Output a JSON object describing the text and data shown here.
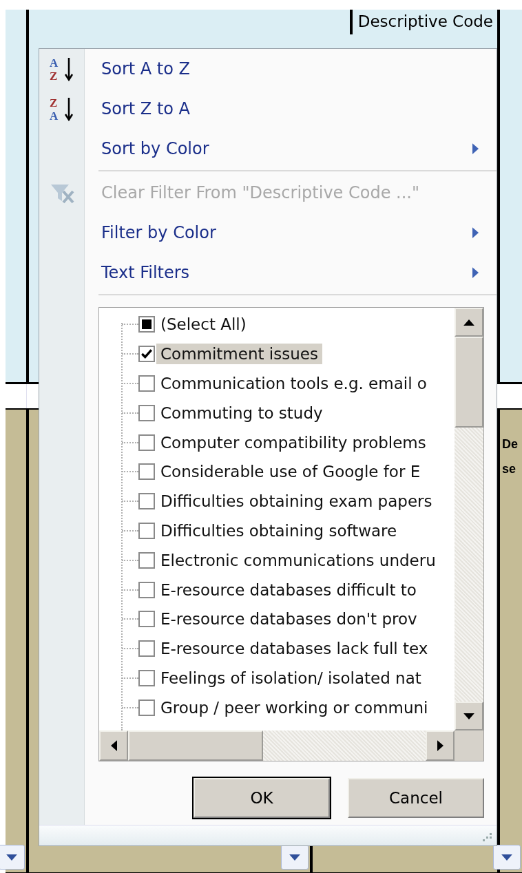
{
  "sheet": {
    "header_cell": "Descriptive Code",
    "cell_fragment": [
      "De",
      "se"
    ]
  },
  "menu": {
    "items": [
      {
        "kind": "command",
        "label": "Sort A to Z",
        "icon_text": [
          "A",
          "Z"
        ],
        "disabled": false,
        "submenu": false
      },
      {
        "kind": "command",
        "label": "Sort Z to A",
        "icon_text": [
          "Z",
          "A"
        ],
        "disabled": false,
        "submenu": false
      },
      {
        "kind": "command",
        "label": "Sort by Color",
        "disabled": false,
        "submenu": true
      },
      {
        "kind": "separator"
      },
      {
        "kind": "command",
        "label": "Clear Filter From \"Descriptive Code ...\"",
        "disabled": true,
        "submenu": false
      },
      {
        "kind": "command",
        "label": "Filter by Color",
        "disabled": false,
        "submenu": true
      },
      {
        "kind": "command",
        "label": "Text Filters",
        "disabled": false,
        "submenu": true
      },
      {
        "kind": "separator"
      }
    ],
    "values": [
      {
        "label": "(Select All)",
        "checked": false,
        "indeterminate": true,
        "selected": false
      },
      {
        "label": "Commitment issues",
        "checked": true,
        "selected": true
      },
      {
        "label": "Communication tools e.g. email o",
        "checked": false,
        "selected": false
      },
      {
        "label": "Commuting to study",
        "checked": false,
        "selected": false
      },
      {
        "label": "Computer compatibility problems",
        "checked": false,
        "selected": false
      },
      {
        "label": "Considerable use of Google for E",
        "checked": false,
        "selected": false
      },
      {
        "label": "Difficulties obtaining exam papers",
        "checked": false,
        "selected": false
      },
      {
        "label": "Difficulties obtaining software",
        "checked": false,
        "selected": false
      },
      {
        "label": "Electronic communications underu",
        "checked": false,
        "selected": false
      },
      {
        "label": "E-resource databases difficult to",
        "checked": false,
        "selected": false
      },
      {
        "label": "E-resource databases don't prov",
        "checked": false,
        "selected": false
      },
      {
        "label": "E-resource databases lack full tex",
        "checked": false,
        "selected": false
      },
      {
        "label": "Feelings of isolation/ isolated nat",
        "checked": false,
        "selected": false
      },
      {
        "label": "Group / peer working or communi",
        "checked": false,
        "selected": false
      }
    ],
    "buttons": [
      {
        "label": "OK",
        "default": true
      },
      {
        "label": "Cancel",
        "default": false
      }
    ]
  }
}
